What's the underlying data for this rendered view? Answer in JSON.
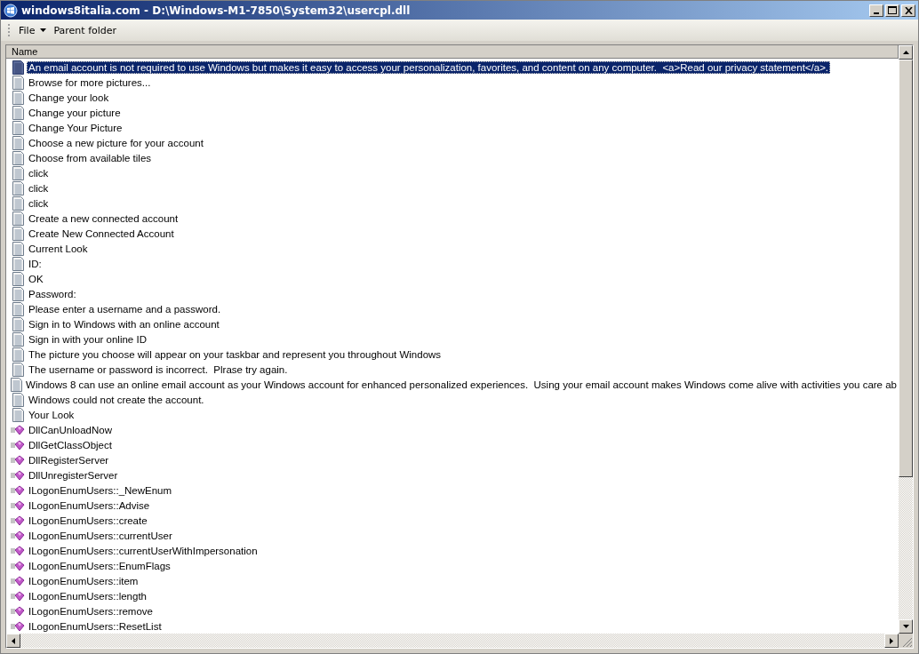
{
  "window": {
    "title": "windows8italia.com - D:\\Windows-M1-7850\\System32\\usercpl.dll"
  },
  "toolbar": {
    "items": [
      {
        "label": "File",
        "kind": "menu"
      },
      {
        "label": "Parent folder",
        "kind": "button"
      }
    ]
  },
  "list": {
    "columns": [
      "Name"
    ],
    "rows": [
      {
        "name": "An email account is not required to use Windows but makes it easy to access your personalization, favorites, and content on any computer.  <a>Read our privacy statement</a>.",
        "kind": "string",
        "selected": true
      },
      {
        "name": "Browse for more pictures...",
        "kind": "string",
        "selected": false
      },
      {
        "name": "Change your look",
        "kind": "string",
        "selected": false
      },
      {
        "name": "Change your picture",
        "kind": "string",
        "selected": false
      },
      {
        "name": "Change Your Picture",
        "kind": "string",
        "selected": false
      },
      {
        "name": "Choose a new picture for your account",
        "kind": "string",
        "selected": false
      },
      {
        "name": "Choose from available tiles",
        "kind": "string",
        "selected": false
      },
      {
        "name": "click",
        "kind": "string",
        "selected": false
      },
      {
        "name": "click",
        "kind": "string",
        "selected": false
      },
      {
        "name": "click",
        "kind": "string",
        "selected": false
      },
      {
        "name": "Create a new connected account",
        "kind": "string",
        "selected": false
      },
      {
        "name": "Create New Connected Account",
        "kind": "string",
        "selected": false
      },
      {
        "name": "Current Look",
        "kind": "string",
        "selected": false
      },
      {
        "name": "ID:",
        "kind": "string",
        "selected": false
      },
      {
        "name": "OK",
        "kind": "string",
        "selected": false
      },
      {
        "name": "Password:",
        "kind": "string",
        "selected": false
      },
      {
        "name": "Please enter a username and a password.",
        "kind": "string",
        "selected": false
      },
      {
        "name": "Sign in to Windows with an online account",
        "kind": "string",
        "selected": false
      },
      {
        "name": "Sign in with your online ID",
        "kind": "string",
        "selected": false
      },
      {
        "name": "The picture you choose will appear on your taskbar and represent you throughout Windows",
        "kind": "string",
        "selected": false
      },
      {
        "name": "The username or password is incorrect.  Plrase try again.",
        "kind": "string",
        "selected": false
      },
      {
        "name": "Windows 8 can use an online email account as your Windows account for enhanced personalized experiences.  Using your email account makes Windows come alive with activities you care ab",
        "kind": "string",
        "selected": false
      },
      {
        "name": "Windows could not create the account.",
        "kind": "string",
        "selected": false
      },
      {
        "name": "Your Look",
        "kind": "string",
        "selected": false
      },
      {
        "name": "DllCanUnloadNow",
        "kind": "export",
        "selected": false
      },
      {
        "name": "DllGetClassObject",
        "kind": "export",
        "selected": false
      },
      {
        "name": "DllRegisterServer",
        "kind": "export",
        "selected": false
      },
      {
        "name": "DllUnregisterServer",
        "kind": "export",
        "selected": false
      },
      {
        "name": "ILogonEnumUsers::_NewEnum",
        "kind": "export",
        "selected": false
      },
      {
        "name": "ILogonEnumUsers::Advise",
        "kind": "export",
        "selected": false
      },
      {
        "name": "ILogonEnumUsers::create",
        "kind": "export",
        "selected": false
      },
      {
        "name": "ILogonEnumUsers::currentUser",
        "kind": "export",
        "selected": false
      },
      {
        "name": "ILogonEnumUsers::currentUserWithImpersonation",
        "kind": "export",
        "selected": false
      },
      {
        "name": "ILogonEnumUsers::EnumFlags",
        "kind": "export",
        "selected": false
      },
      {
        "name": "ILogonEnumUsers::item",
        "kind": "export",
        "selected": false
      },
      {
        "name": "ILogonEnumUsers::length",
        "kind": "export",
        "selected": false
      },
      {
        "name": "ILogonEnumUsers::remove",
        "kind": "export",
        "selected": false
      },
      {
        "name": "ILogonEnumUsers::ResetList",
        "kind": "export",
        "selected": false
      }
    ]
  }
}
